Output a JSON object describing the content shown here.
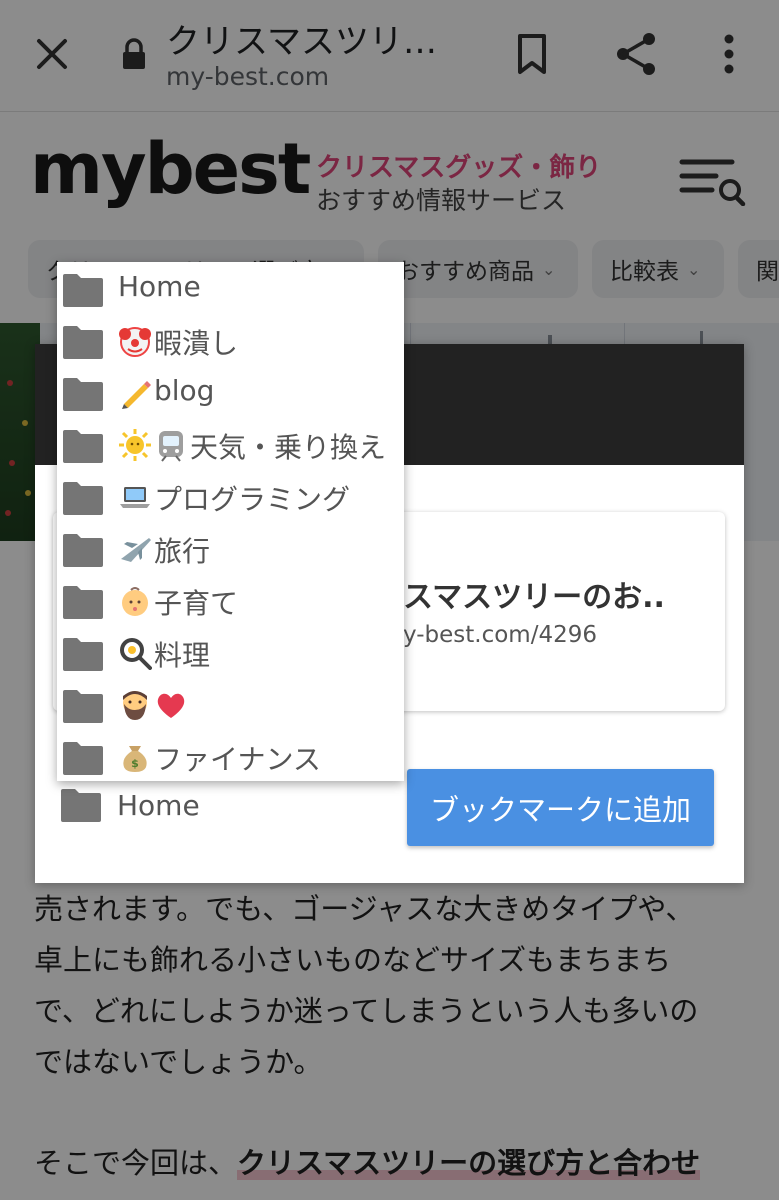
{
  "browser": {
    "title": "クリスマスツリ…",
    "url": "my-best.com",
    "icons": [
      "close-icon",
      "lock-icon",
      "bookmark-icon",
      "share-icon",
      "more-vert-icon"
    ]
  },
  "site": {
    "logo": "mybest",
    "tagline_main": "クリスマスグッズ・飾り",
    "tagline_sub": "おすすめ情報サービス",
    "brand_color": "#e0457b",
    "nav_chips": [
      {
        "label": "クリスマスツリーの選び方",
        "has_dropdown": true
      },
      {
        "label": "おすすめ商品",
        "has_dropdown": true
      },
      {
        "label": "比較表",
        "has_dropdown": true
      },
      {
        "label": "関",
        "has_dropdown": false
      }
    ]
  },
  "article": {
    "paragraph1": [
      "売されます。でも、ゴージャスな大きめタイプや、",
      "卓上にも飾れる小さいものなどサイズもまちまち",
      "で、どれにしようか迷ってしまうという人も多いの",
      "ではないでしょうか。"
    ],
    "paragraph2_lead": "そこで今回は、",
    "paragraph2_highlight": "クリスマスツリーの選び方と合わせ"
  },
  "dialog": {
    "card_title": "スマスツリーのお..",
    "card_url": "y-best.com/4296",
    "selected_folder": "Home",
    "add_button": "ブックマークに追加",
    "button_color": "#4a90e2"
  },
  "folder_menu": {
    "items": [
      {
        "label": "Home",
        "emoji": []
      },
      {
        "label": "暇潰し",
        "emoji": [
          "clown-face"
        ]
      },
      {
        "label": "blog",
        "emoji": [
          "pencil"
        ]
      },
      {
        "label": "天気・乗り換え",
        "emoji": [
          "sun-with-face",
          "train"
        ]
      },
      {
        "label": "プログラミング",
        "emoji": [
          "laptop"
        ]
      },
      {
        "label": "旅行",
        "emoji": [
          "airplane"
        ]
      },
      {
        "label": "子育て",
        "emoji": [
          "baby"
        ]
      },
      {
        "label": "料理",
        "emoji": [
          "cooking"
        ]
      },
      {
        "label": "",
        "emoji": [
          "bearded-man",
          "red-heart"
        ]
      },
      {
        "label": "ファイナンス",
        "emoji": [
          "money-bag"
        ]
      }
    ]
  }
}
